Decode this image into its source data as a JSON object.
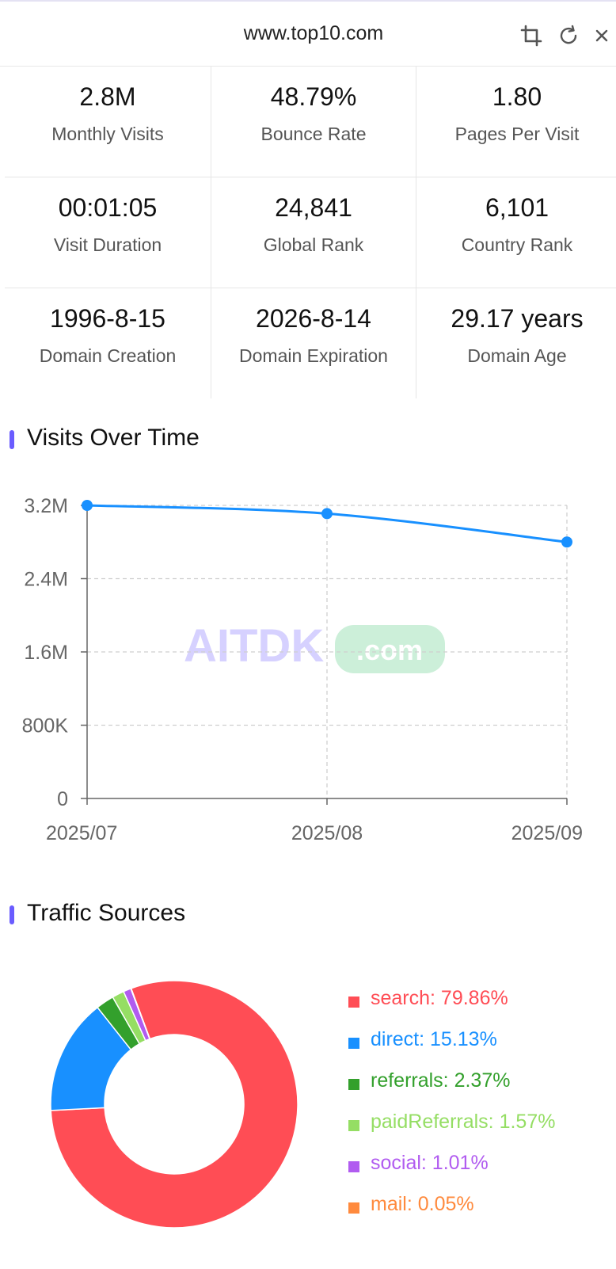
{
  "header": {
    "title": "www.top10.com",
    "icons": [
      "crop-icon",
      "refresh-icon",
      "close-icon"
    ]
  },
  "stats": [
    [
      {
        "value": "2.8M",
        "label": "Monthly Visits"
      },
      {
        "value": "48.79%",
        "label": "Bounce Rate"
      },
      {
        "value": "1.80",
        "label": "Pages Per Visit"
      }
    ],
    [
      {
        "value": "00:01:05",
        "label": "Visit Duration"
      },
      {
        "value": "24,841",
        "label": "Global Rank"
      },
      {
        "value": "6,101",
        "label": "Country Rank"
      }
    ],
    [
      {
        "value": "1996-8-15",
        "label": "Domain Creation"
      },
      {
        "value": "2026-8-14",
        "label": "Domain Expiration"
      },
      {
        "value": "29.17 years",
        "label": "Domain Age"
      }
    ]
  ],
  "visits_section": {
    "title": "Visits Over Time"
  },
  "traffic_section": {
    "title": "Traffic Sources"
  },
  "watermark": {
    "text_left": "AITDK",
    "text_right": ".com"
  },
  "colors": {
    "accent": "#6a5cff",
    "line": "#1890ff",
    "search": "#ff4d55",
    "direct": "#1890ff",
    "referrals": "#33a02c",
    "paidReferrals": "#95de64",
    "social": "#b15cf0",
    "mail": "#ff8a3d"
  },
  "chart_data": [
    {
      "type": "line",
      "title": "Visits Over Time",
      "x": [
        "2025/07",
        "2025/08",
        "2025/09"
      ],
      "series": [
        {
          "values": [
            3200000,
            3110000,
            2800000
          ]
        }
      ],
      "ylim": [
        0,
        3200000
      ],
      "yticks": [
        0,
        800000,
        1600000,
        2400000,
        3200000
      ],
      "ytick_labels": [
        "0",
        "800K",
        "1.6M",
        "2.4M",
        "3.2M"
      ],
      "grid": true
    },
    {
      "type": "pie",
      "title": "Traffic Sources",
      "donut": true,
      "categories": [
        "search",
        "direct",
        "referrals",
        "paidReferrals",
        "social",
        "mail"
      ],
      "values": [
        79.86,
        15.13,
        2.37,
        1.57,
        1.01,
        0.05
      ],
      "legend_labels": [
        "search: 79.86%",
        "direct: 15.13%",
        "referrals: 2.37%",
        "paidReferrals: 1.57%",
        "social: 1.01%",
        "mail: 0.05%"
      ],
      "legend_position": "right"
    }
  ]
}
